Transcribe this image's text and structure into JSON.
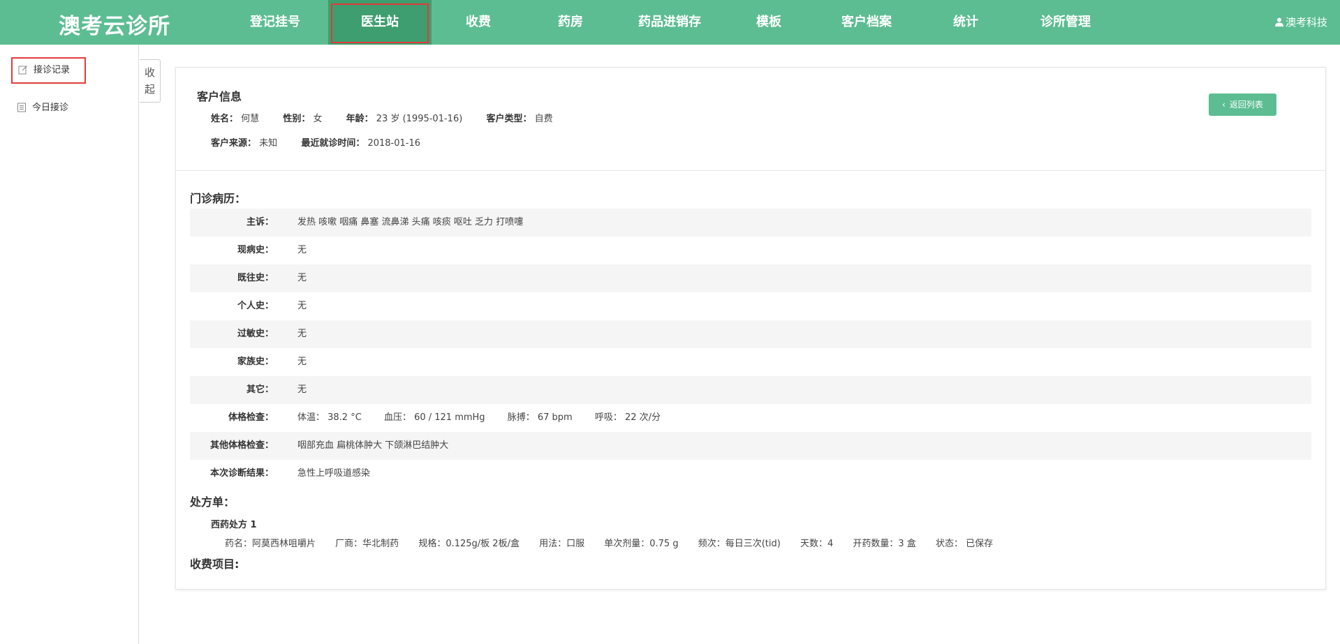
{
  "app": {
    "logo": "澳考云诊所",
    "user": "澳考科技"
  },
  "nav": {
    "items": [
      {
        "label": "登记挂号"
      },
      {
        "label": "医生站",
        "active": true
      },
      {
        "label": "收费"
      },
      {
        "label": "药房"
      },
      {
        "label": "药品进销存"
      },
      {
        "label": "模板"
      },
      {
        "label": "客户档案"
      },
      {
        "label": "统计"
      },
      {
        "label": "诊所管理"
      }
    ]
  },
  "sidebar": {
    "items": [
      {
        "label": "接诊记录",
        "icon": "edit-icon",
        "selected": true
      },
      {
        "label": "今日接诊",
        "icon": "list-icon"
      }
    ],
    "collapse_label": "收起"
  },
  "customer": {
    "title": "客户信息",
    "back_label": "返回列表",
    "name_label": "姓名：",
    "name": "何慧",
    "gender_label": "性别：",
    "gender": "女",
    "age_label": "年龄：",
    "age": "23 岁 (1995-01-16)",
    "type_label": "客户类型：",
    "type": "自费",
    "source_label": "客户来源：",
    "source": "未知",
    "last_visit_label": "最近就诊时间：",
    "last_visit": "2018-01-16"
  },
  "record": {
    "title": "门诊病历：",
    "rows": [
      {
        "label": "主诉：",
        "value": "发热 咳嗽 咽痛 鼻塞 流鼻涕 头痛 咳痰 呕吐 乏力 打喷嚏"
      },
      {
        "label": "现病史：",
        "value": "无"
      },
      {
        "label": "既往史：",
        "value": "无"
      },
      {
        "label": "个人史：",
        "value": "无"
      },
      {
        "label": "过敏史：",
        "value": "无"
      },
      {
        "label": "家族史：",
        "value": "无"
      },
      {
        "label": "其它：",
        "value": "无"
      }
    ],
    "exam": {
      "label": "体格检查：",
      "temp": "体温： 38.2 °C",
      "bp": "血压： 60 / 121 mmHg",
      "pulse": "脉搏： 67 bpm",
      "resp": "呼吸： 22 次/分"
    },
    "other_exam": {
      "label": "其他体格检查：",
      "value": "咽部充血 扁桃体肿大 下颌淋巴结肿大"
    },
    "diagnosis": {
      "label": "本次诊断结果：",
      "value": "急性上呼吸道感染"
    }
  },
  "prescription": {
    "title": "处方单：",
    "rx_title": "西药处方 1",
    "drug": "药名：阿莫西林咀嚼片",
    "maker": "厂商：华北制药",
    "spec": "规格：0.125g/板 2板/盒",
    "usage": "用法：口服",
    "dose": "单次剂量：0.75 g",
    "freq": "频次：每日三次(tid)",
    "days": "天数：4",
    "qty": "开药数量：3 盒",
    "status": "状态： 已保存"
  },
  "fees": {
    "title": "收费项目:"
  },
  "colors": {
    "brand": "#5cbd92",
    "active_nav": "#3f9e6f",
    "highlight": "#e03b3b"
  }
}
